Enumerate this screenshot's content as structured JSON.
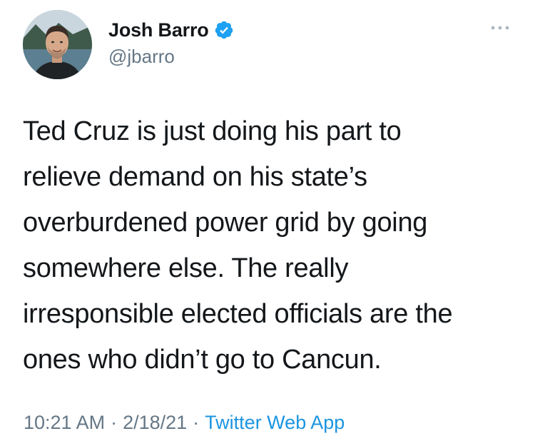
{
  "author": {
    "display_name": "Josh Barro",
    "handle": "@jbarro",
    "verified": true,
    "avatar_icon": "profile-photo"
  },
  "tweet": {
    "text": "Ted Cruz is just doing his part to\nrelieve demand on his state’s\noverburdened power grid by going\nsomewhere else. The really\nirresponsible elected officials are the\nones who didn’t go to Cancun."
  },
  "meta": {
    "time": "10:21 AM",
    "separator": "·",
    "date": "2/18/21",
    "source": "Twitter Web App"
  },
  "icons": {
    "verified": "verified-badge-icon",
    "more": "more-options-icon"
  },
  "colors": {
    "text": "#14171a",
    "secondary": "#657786",
    "link": "#1b95e0",
    "verified": "#1da1f2"
  }
}
